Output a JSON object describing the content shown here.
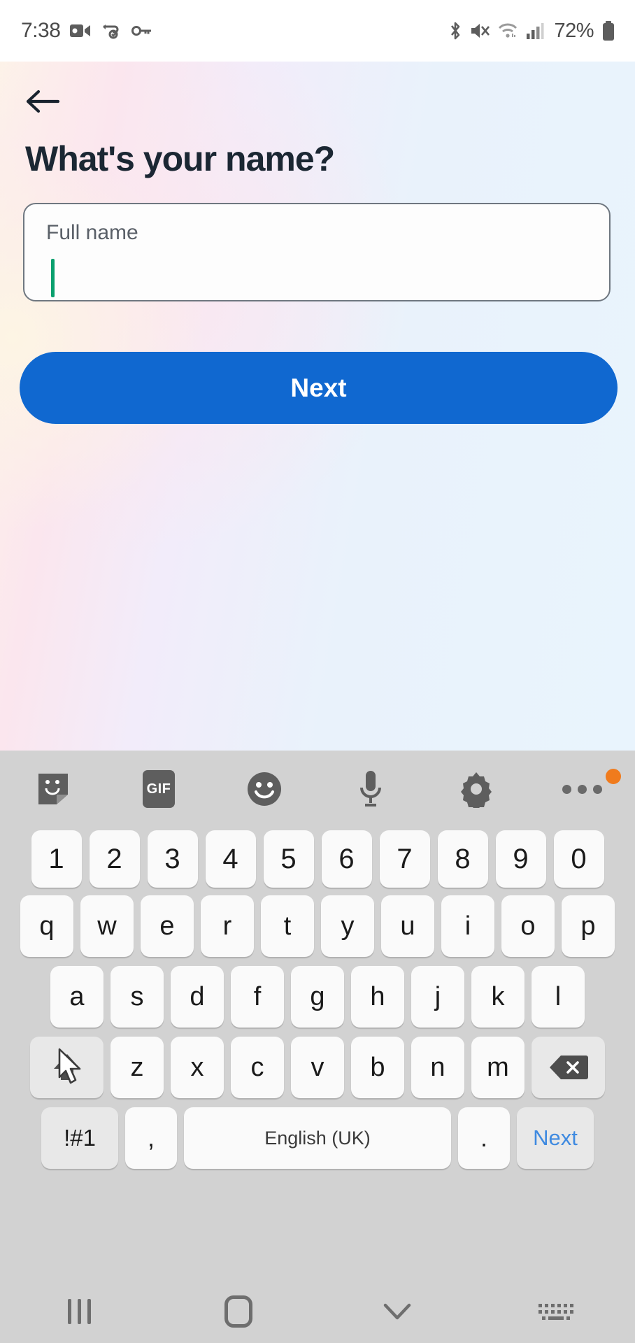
{
  "status_bar": {
    "time": "7:38",
    "left_icons": [
      "video-camera-icon",
      "vpn-key-sync-icon",
      "key-icon"
    ],
    "right_icons": [
      "bluetooth-icon",
      "mute-icon",
      "wifi-icon",
      "signal-icon"
    ],
    "battery_percent": "72%"
  },
  "screen": {
    "back_label": "back-arrow",
    "title": "What's your name?",
    "field": {
      "label": "Full name",
      "value": ""
    },
    "next_button": "Next",
    "accent_color": "#1068d0",
    "caret_color": "#0aa06e"
  },
  "keyboard": {
    "toolbar": [
      {
        "name": "sticker-icon",
        "label": ""
      },
      {
        "name": "gif-icon",
        "label": "GIF"
      },
      {
        "name": "emoji-icon",
        "label": ""
      },
      {
        "name": "microphone-icon",
        "label": ""
      },
      {
        "name": "settings-gear-icon",
        "label": ""
      },
      {
        "name": "more-options-icon",
        "label": ""
      }
    ],
    "row_numbers": [
      "1",
      "2",
      "3",
      "4",
      "5",
      "6",
      "7",
      "8",
      "9",
      "0"
    ],
    "row_top": [
      "q",
      "w",
      "e",
      "r",
      "t",
      "y",
      "u",
      "i",
      "o",
      "p"
    ],
    "row_home": [
      "a",
      "s",
      "d",
      "f",
      "g",
      "h",
      "j",
      "k",
      "l"
    ],
    "row_bottom": [
      "z",
      "x",
      "c",
      "v",
      "b",
      "n",
      "m"
    ],
    "shift_key": "shift-icon",
    "backspace_key": "backspace-icon",
    "symbols_key": "!#1",
    "comma_key": ",",
    "space_key": "English (UK)",
    "period_key": ".",
    "enter_key": "Next",
    "enter_key_color": "#3f8ae0"
  },
  "navbar": {
    "recents": "recents-icon",
    "home": "home-icon",
    "hide_keyboard": "chevron-down-icon",
    "switch_keyboard": "keyboard-icon"
  }
}
